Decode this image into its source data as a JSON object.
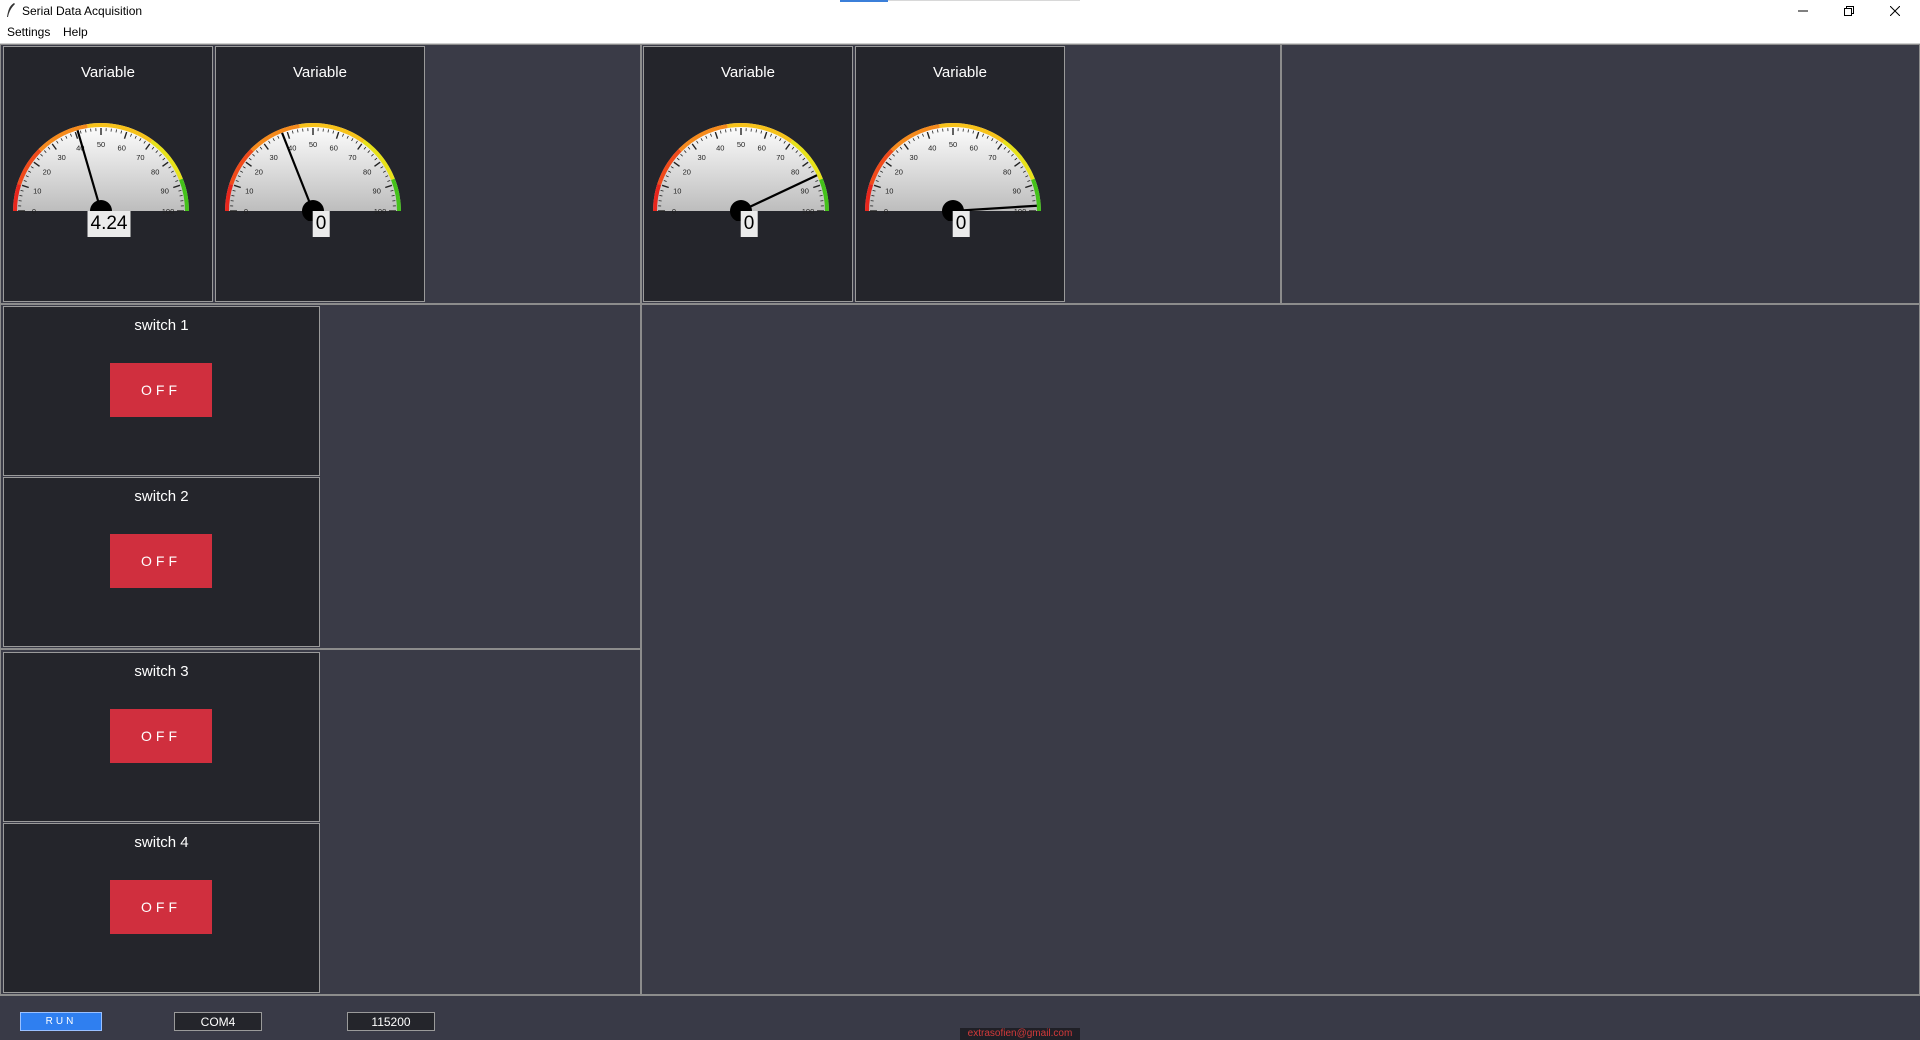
{
  "window": {
    "title": "Serial Data Acquisition",
    "icon": "feather-icon"
  },
  "menu": {
    "items": [
      {
        "label": "Settings"
      },
      {
        "label": "Help"
      }
    ]
  },
  "gauges": [
    {
      "title": "Variable",
      "value_display": "4.24",
      "needle_value": 41
    },
    {
      "title": "Variable",
      "value_display": "0",
      "needle_value": 38
    },
    {
      "title": "Variable",
      "value_display": "0",
      "needle_value": 86
    },
    {
      "title": "Variable",
      "value_display": "0",
      "needle_value": 98
    }
  ],
  "gauge_scale": {
    "min": 0,
    "max": 100,
    "tick_labels": [
      "0",
      "10",
      "20",
      "30",
      "40",
      "50",
      "60",
      "70",
      "80",
      "90",
      "100"
    ]
  },
  "switches": [
    {
      "title": "switch 1",
      "state": "OFF"
    },
    {
      "title": "switch 2",
      "state": "OFF"
    },
    {
      "title": "switch 3",
      "state": "OFF"
    },
    {
      "title": "switch 4",
      "state": "OFF"
    }
  ],
  "statusbar": {
    "run_label": "RUN",
    "port": "COM4",
    "baud": "115200",
    "email": "extrasofien@gmail.com"
  },
  "colors": {
    "off_button": "#d02f3e",
    "run_button": "#2f7ff0",
    "background": "#393a47",
    "panel": "#24252b"
  }
}
